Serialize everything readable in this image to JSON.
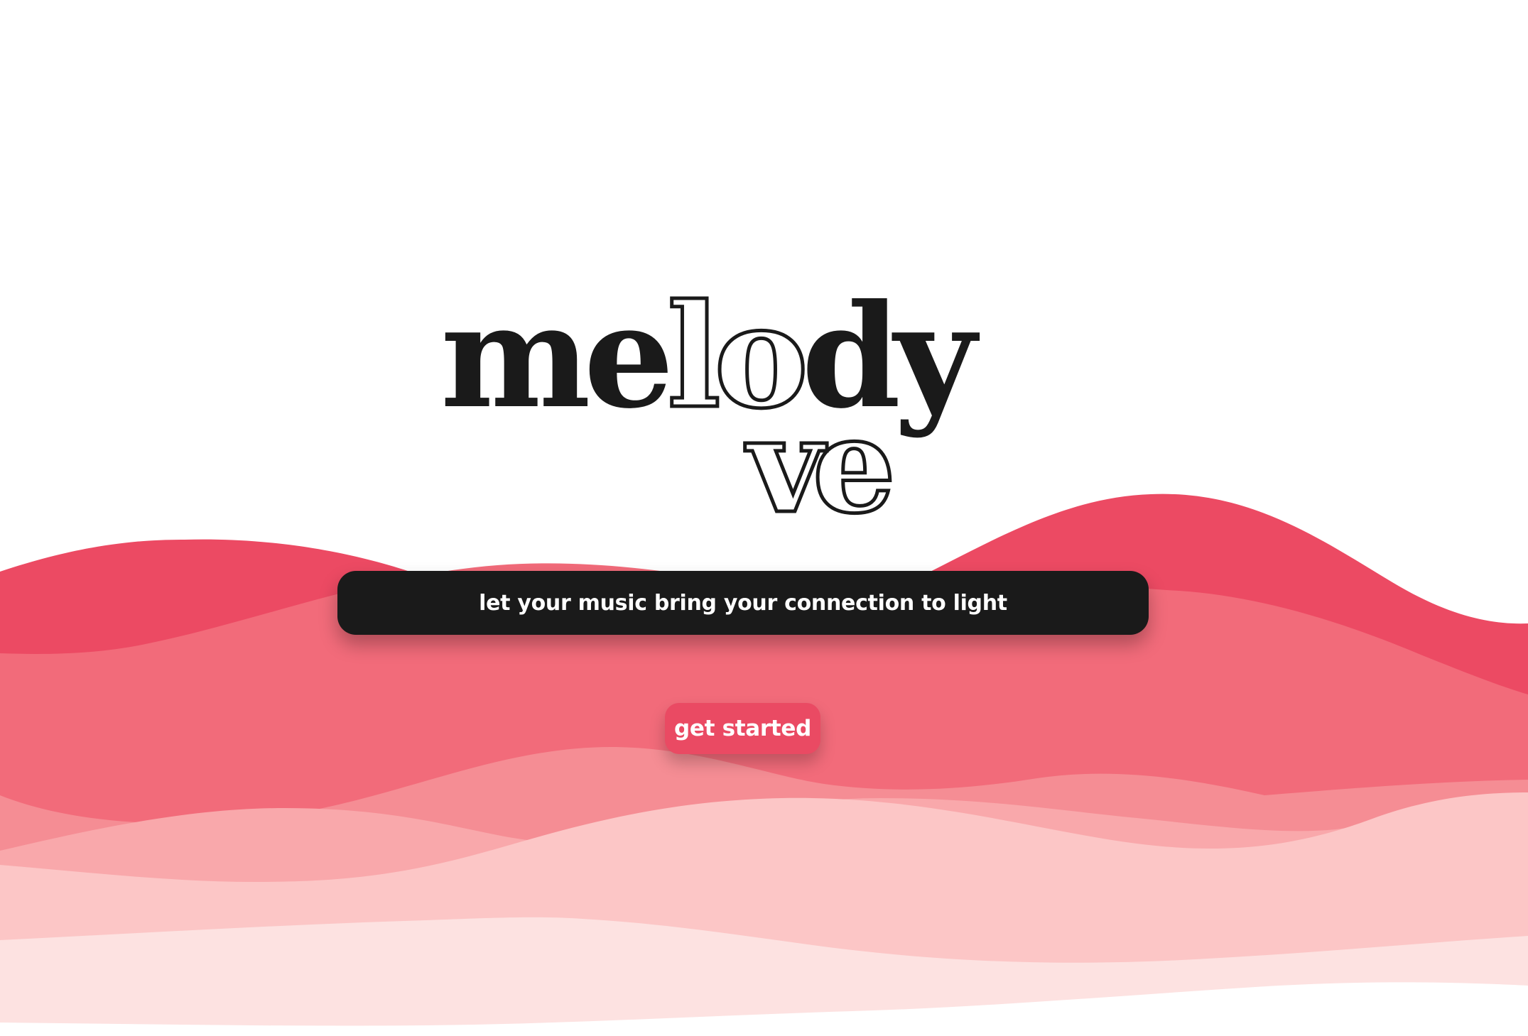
{
  "brand": {
    "logo_line1_prefix": "me",
    "logo_line1_outline": "lo",
    "logo_line1_suffix": "dy",
    "logo_line2": "ve",
    "logo_color": "#1a1a1a"
  },
  "hero": {
    "tagline": "let your music bring your connection to light",
    "cta_label": "get started"
  },
  "colors": {
    "primary": "#ea4a63",
    "wave_1": "#ec4a63",
    "wave_2": "#f26b7a",
    "wave_3": "#f58d94",
    "wave_4": "#f9a8ab",
    "wave_5": "#fcc6c6",
    "wave_6": "#fde2e1",
    "background": "#ffffff",
    "tagline_bg": "#1a1a1a"
  }
}
